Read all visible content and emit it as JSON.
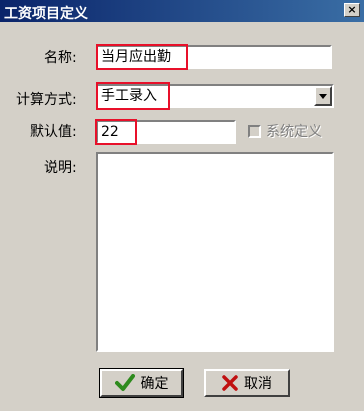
{
  "window": {
    "title": "工资项目定义",
    "close_label": "×"
  },
  "form": {
    "name_label": "名称:",
    "name_value": "当月应出勤",
    "calc_label": "计算方式:",
    "calc_value": "手工录入",
    "default_label": "默认值:",
    "default_value": "22",
    "system_label": "系统定义",
    "system_checked": false,
    "desc_label": "说明:",
    "desc_value": ""
  },
  "buttons": {
    "ok_label": "确定",
    "cancel_label": "取消"
  },
  "colors": {
    "highlight": "#e8102a",
    "ok_icon": "#2e8b1e",
    "cancel_icon": "#c01010"
  },
  "icons": {
    "ok": "checkmark-icon",
    "cancel": "x-icon",
    "dropdown": "chevron-down-icon"
  }
}
